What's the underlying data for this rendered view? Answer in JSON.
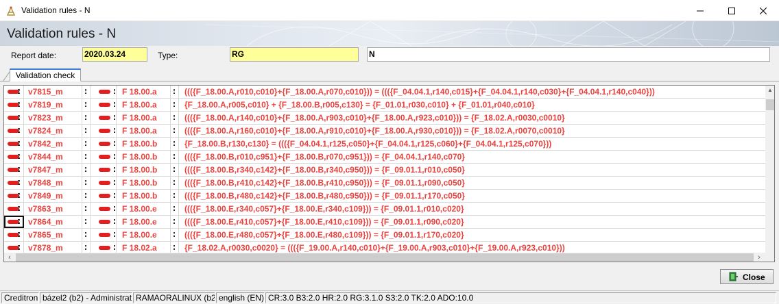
{
  "window": {
    "title": "Validation rules - N",
    "minimize_icon": "minimize-icon",
    "maximize_icon": "maximize-icon",
    "close_icon": "close-icon"
  },
  "banner": {
    "title": "Validation rules - N"
  },
  "report": {
    "date_label": "Report date:",
    "date_value": "2020.03.24",
    "type_label": "Type:",
    "type_value": "RG",
    "name_value": "N"
  },
  "tabs": [
    {
      "label": "Validation check",
      "active": true
    }
  ],
  "grid": {
    "rows": [
      {
        "code": "v7815_m",
        "table": "F 18.00.a",
        "formula": "((({F_18.00.A,r010,c010}+{F_18.00.A,r070,c010})) = ((({F_04.04.1,r140,c015}+{F_04.04.1,r140,c030}+{F_04.04.1,r140,c040}))"
      },
      {
        "code": "v7819_m",
        "table": "F 18.00.a",
        "formula": "{F_18.00.A,r005,c010} + {F_18.00.B,r005,c130} = {F_01.01,r030,c010} + {F_01.01,r040,c010}"
      },
      {
        "code": "v7823_m",
        "table": "F 18.00.a",
        "formula": "((({F_18.00.A,r140,c010}+{F_18.00.A,r903,c010}+{F_18.00.A,r923,c010})) = {F_18.02.A,r0030,c0010}"
      },
      {
        "code": "v7824_m",
        "table": "F 18.00.a",
        "formula": "((({F_18.00.A,r160,c010}+{F_18.00.A,r910,c010}+{F_18.00.A,r930,c010})) = {F_18.02.A,r0070,c0010}"
      },
      {
        "code": "v7842_m",
        "table": "F 18.00.b",
        "formula": "{F_18.00.B,r130,c130} = ((({F_04.04.1,r125,c050}+{F_04.04.1,r125,c060}+{F_04.04.1,r125,c070}))"
      },
      {
        "code": "v7844_m",
        "table": "F 18.00.b",
        "formula": "((({F_18.00.B,r010,c951}+{F_18.00.B,r070,c951})) = {F_04.04.1,r140,c070}"
      },
      {
        "code": "v7847_m",
        "table": "F 18.00.b",
        "formula": "((({F_18.00.B,r340,c142}+{F_18.00.B,r340,c950})) = {F_09.01.1,r010,c050}"
      },
      {
        "code": "v7848_m",
        "table": "F 18.00.b",
        "formula": "((({F_18.00.B,r410,c142}+{F_18.00.B,r410,c950})) = {F_09.01.1,r090,c050}"
      },
      {
        "code": "v7849_m",
        "table": "F 18.00.b",
        "formula": "((({F_18.00.B,r480,c142}+{F_18.00.B,r480,c950})) = {F_09.01.1,r170,c050}"
      },
      {
        "code": "v7863_m",
        "table": "F 18.00.e",
        "formula": "((({F_18.00.E,r340,c057}+{F_18.00.E,r340,c109})) = {F_09.01.1,r010,c020}"
      },
      {
        "code": "v7864_m",
        "table": "F 18.00.e",
        "formula": "((({F_18.00.E,r410,c057}+{F_18.00.E,r410,c109})) = {F_09.01.1,r090,c020}"
      },
      {
        "code": "v7865_m",
        "table": "F 18.00.e",
        "formula": "((({F_18.00.E,r480,c057}+{F_18.00.E,r480,c109})) = {F_09.01.1,r170,c020}"
      },
      {
        "code": "v7878_m",
        "table": "F 18.02.a",
        "formula": "{F_18.02.A,r0030,c0020} = ((({F_19.00.A,r140,c010}+{F_19.00.A,r903,c010}+{F_19.00.A,r923,c010}))"
      }
    ],
    "selected_row": 10,
    "status_icon": "error-status-icon",
    "error_color": "#e8433f"
  },
  "buttons": {
    "close_label": "Close"
  },
  "statusbar": [
    "Creditron",
    "bázel2 (b2) - Administrat",
    "RAMAORALINUX (b2)",
    "english (EN)",
    "CR:3.0  B3:2.0  HR:2.0  RG:3.1.0  S3:2.0  TK:2.0  ADO:10.0"
  ]
}
